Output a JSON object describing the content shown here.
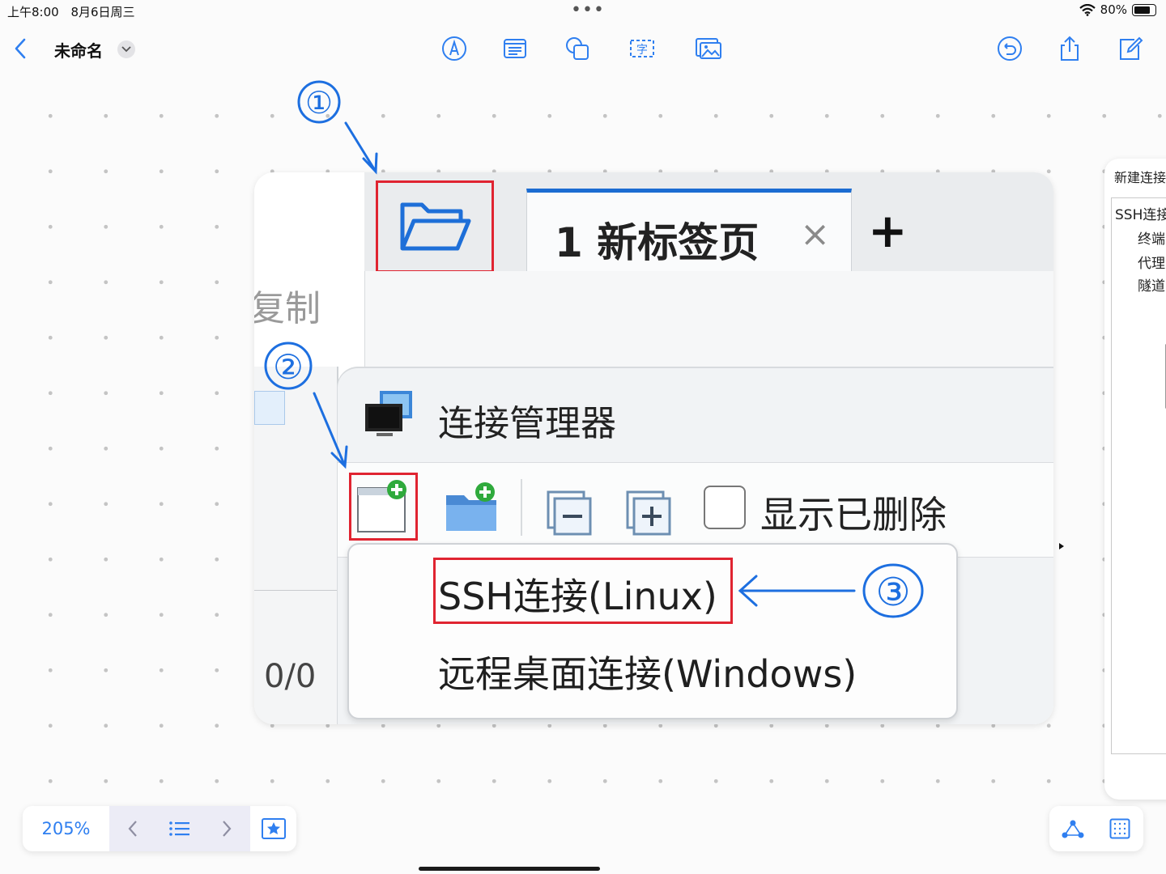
{
  "status_bar": {
    "time": "上午8:00",
    "date": "8月6日周三",
    "battery": "80%",
    "battery_level": 0.8
  },
  "toolbar": {
    "doc_title": "未命名"
  },
  "canvas": {
    "annotations": {
      "step1": "①",
      "step2": "②",
      "step3": "③"
    },
    "screenshot": {
      "tab_label": "1 新标签页",
      "tab_close": "×",
      "new_tab_plus": "+",
      "copy_label": "复制",
      "counter": "0/0",
      "conn_manager_title": "连接管理器",
      "show_deleted_label": "显示已删除",
      "menu_items": [
        "SSH连接(Linux)",
        "远程桌面连接(Windows)"
      ]
    },
    "side_peek": {
      "title": "新建连接",
      "tree": [
        "SSH连接",
        "终端",
        "代理",
        "隧道"
      ]
    }
  },
  "bottom_bar": {
    "zoom": "205%"
  },
  "colors": {
    "accent": "#2f7ff0",
    "annotation_blue": "#1d6fe0",
    "highlight_red": "#e02431",
    "tab_accent": "#1b6cd2"
  }
}
